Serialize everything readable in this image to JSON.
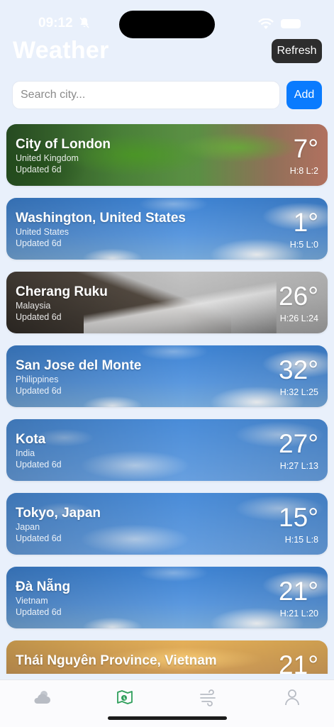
{
  "status_bar": {
    "time": "09:12"
  },
  "header": {
    "title": "Weather",
    "refresh_label": "Refresh"
  },
  "search": {
    "placeholder": "Search city...",
    "value": "",
    "add_label": "Add"
  },
  "cities": [
    {
      "name": "City of London",
      "country": "United Kingdom",
      "updated": "Updated 6d",
      "temp": "7°",
      "hilo": "H:8 L:2",
      "background": "leaves"
    },
    {
      "name": "Washington, United States",
      "country": "United States",
      "updated": "Updated 6d",
      "temp": "1°",
      "hilo": "H:5 L:0",
      "background": "sky"
    },
    {
      "name": "Cherang Ruku",
      "country": "Malaysia",
      "updated": "Updated 6d",
      "temp": "26°",
      "hilo": "H:26 L:24",
      "background": "mountain-rain"
    },
    {
      "name": "San Jose del Monte",
      "country": "Philippines",
      "updated": "Updated 6d",
      "temp": "32°",
      "hilo": "H:32 L:25",
      "background": "sky"
    },
    {
      "name": "Kota",
      "country": "India",
      "updated": "Updated 6d",
      "temp": "27°",
      "hilo": "H:27 L:13",
      "background": "sky"
    },
    {
      "name": "Tokyo, Japan",
      "country": "Japan",
      "updated": "Updated 6d",
      "temp": "15°",
      "hilo": "H:15 L:8",
      "background": "sky"
    },
    {
      "name": "Đà Nẵng",
      "country": "Vietnam",
      "updated": "Updated 6d",
      "temp": "21°",
      "hilo": "H:21 L:20",
      "background": "sky"
    },
    {
      "name": "Thái Nguyên Province, Vietnam",
      "country": "",
      "updated": "",
      "temp": "21°",
      "hilo": "",
      "background": "sunset"
    }
  ],
  "tabs": [
    {
      "icon": "cloud-sun-icon",
      "active": false
    },
    {
      "icon": "map-icon",
      "active": true
    },
    {
      "icon": "wind-icon",
      "active": false
    },
    {
      "icon": "person-icon",
      "active": false
    }
  ],
  "colors": {
    "accent": "#0a7bfe",
    "active_tab": "#2e9e5b",
    "inactive_tab": "#b8bcc4"
  }
}
